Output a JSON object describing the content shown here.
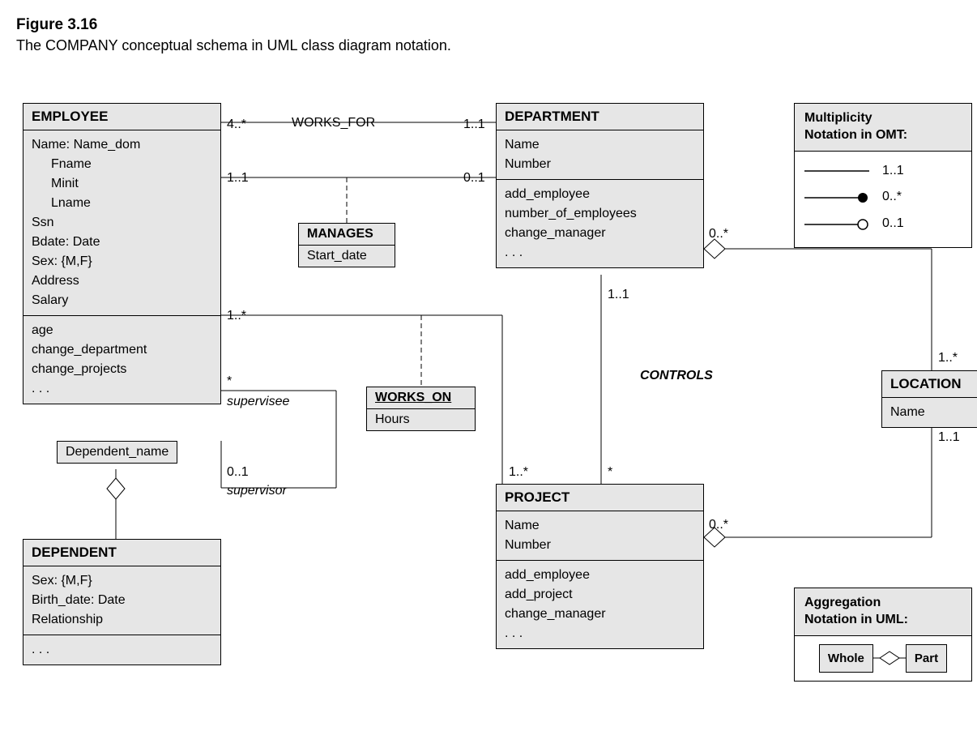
{
  "figure": {
    "title": "Figure 3.16",
    "caption": "The COMPANY conceptual schema in UML class diagram notation."
  },
  "classes": {
    "employee": {
      "name": "EMPLOYEE",
      "attrs": [
        "Name: Name_dom",
        "Fname",
        "Minit",
        "Lname",
        "Ssn",
        "Bdate: Date",
        "Sex: {M,F}",
        "Address",
        "Salary"
      ],
      "ops": [
        "age",
        "change_department",
        "change_projects",
        ". . ."
      ]
    },
    "department": {
      "name": "DEPARTMENT",
      "attrs": [
        "Name",
        "Number"
      ],
      "ops": [
        "add_employee",
        "number_of_employees",
        "change_manager",
        ". . ."
      ]
    },
    "project": {
      "name": "PROJECT",
      "attrs": [
        "Name",
        "Number"
      ],
      "ops": [
        "add_employee",
        "add_project",
        "change_manager",
        ". . ."
      ]
    },
    "dependent": {
      "name": "DEPENDENT",
      "attrs": [
        "Sex: {M,F}",
        "Birth_date: Date",
        "Relationship"
      ],
      "ops": [
        ". . ."
      ]
    },
    "location": {
      "name": "LOCATION",
      "attrs": [
        "Name"
      ]
    }
  },
  "assoc": {
    "works_for": {
      "name": "WORKS_FOR",
      "leftMult": "4..*",
      "rightMult": "1..1"
    },
    "manages": {
      "name": "MANAGES",
      "attr": "Start_date",
      "leftMult": "1..1",
      "rightMult": "0..1"
    },
    "works_on": {
      "name": "WORKS_ON",
      "attr": "Hours",
      "leftMult": "1..*",
      "rightMult": "1..*"
    },
    "controls": {
      "name": "CONTROLS",
      "topMult": "1..1",
      "bottomMult": "*"
    },
    "supervision": {
      "role1": "supervisee",
      "mult1": "*",
      "role2": "supervisor",
      "mult2": "0..1"
    },
    "dependents_of": {
      "qualifier": "Dependent_name"
    },
    "dept_loc": {
      "deptMult": "0..*",
      "locMult": "1..*"
    },
    "proj_loc": {
      "projMult": "0..*",
      "locMult": "1..1"
    }
  },
  "legend": {
    "omt": {
      "title1": "Multiplicity",
      "title2": "Notation in OMT:",
      "rows": [
        "1..1",
        "0..*",
        "0..1"
      ]
    },
    "agg": {
      "title1": "Aggregation",
      "title2": "Notation in UML:",
      "whole": "Whole",
      "part": "Part"
    }
  }
}
